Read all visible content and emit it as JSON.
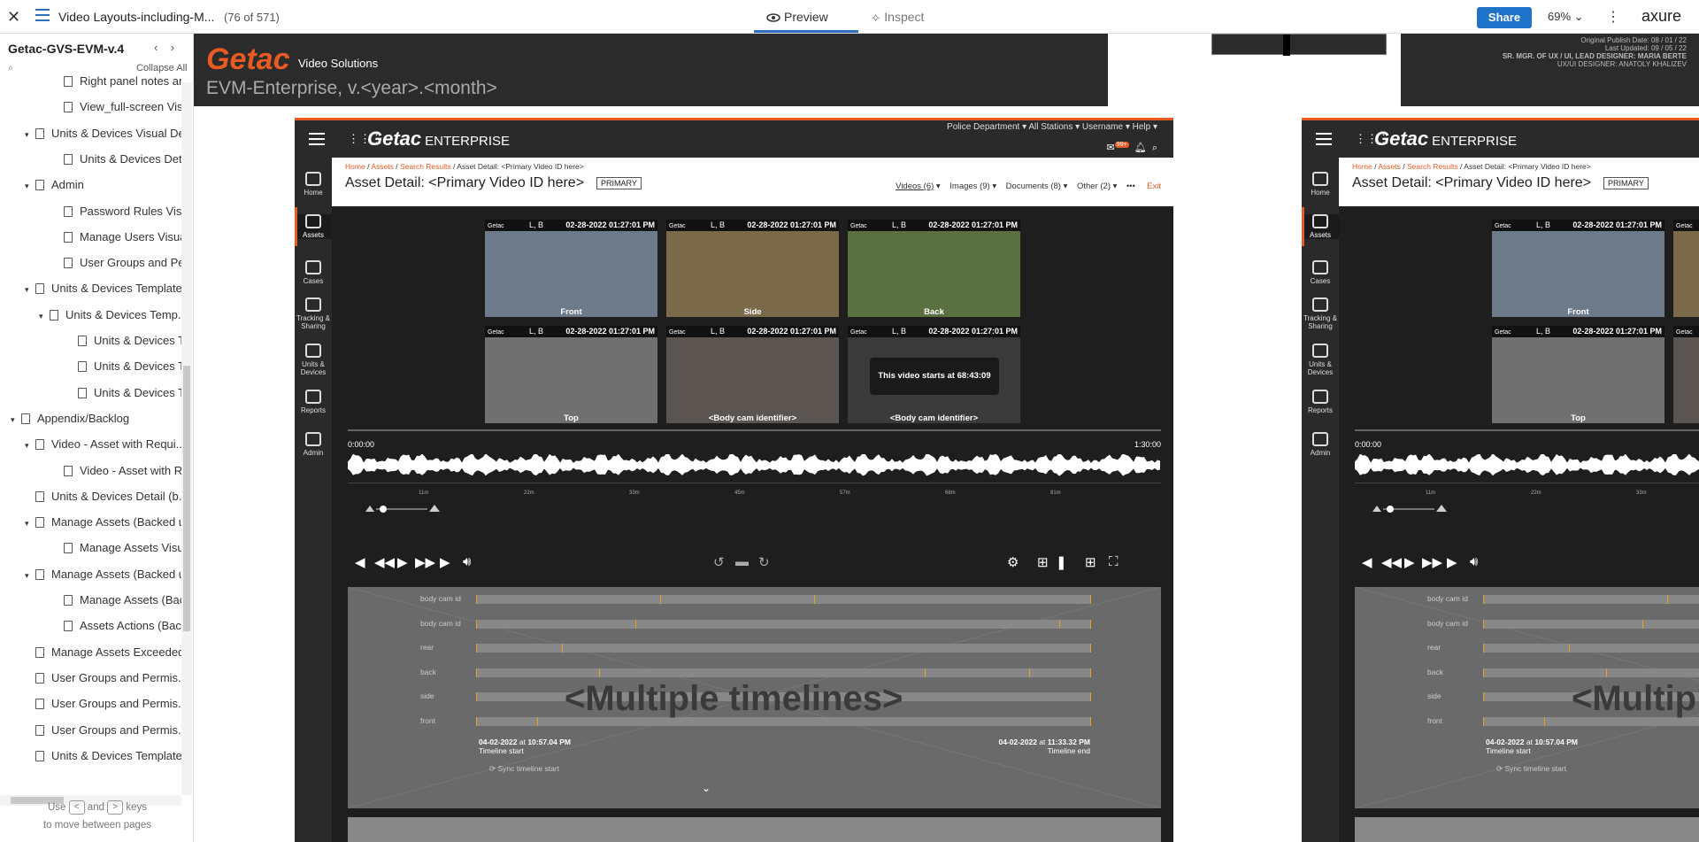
{
  "topbar": {
    "close_glyph": "✕",
    "page_title": "Video Layouts-including-M...",
    "page_count": "(76 of 571)",
    "tab_preview": "Preview",
    "tab_inspect": "Inspect",
    "share": "Share",
    "zoom": "69%",
    "brand": "axure"
  },
  "sidebar": {
    "project": "Getac-GVS-EVM-v.4",
    "collapse_all": "Collapse All",
    "hint_prefix": "Use",
    "hint_and": "and",
    "hint_keys": "keys",
    "hint_line2": "to move between pages",
    "items": [
      {
        "label": "Right panel notes and...",
        "caret": ""
      },
      {
        "label": "View_full-screen Visu...",
        "caret": ""
      },
      {
        "label": "Units & Devices Visual De...",
        "caret": "▾"
      },
      {
        "label": "Units & Devices Detail...",
        "caret": ""
      },
      {
        "label": "Admin",
        "caret": "▾"
      },
      {
        "label": "Password Rules Visual...",
        "caret": ""
      },
      {
        "label": "Manage Users Visual I...",
        "caret": ""
      },
      {
        "label": "User Groups and Perr...",
        "caret": ""
      },
      {
        "label": "Units & Devices Template...",
        "caret": "▾"
      },
      {
        "label": "Units & Devices Temp...",
        "caret": "▾"
      },
      {
        "label": "Units & Devices Te...",
        "caret": ""
      },
      {
        "label": "Units & Devices Te...",
        "caret": ""
      },
      {
        "label": "Units & Devices Te...",
        "caret": ""
      },
      {
        "label": "Appendix/Backlog",
        "caret": "▾"
      },
      {
        "label": "Video - Asset with Requi...",
        "caret": "▾"
      },
      {
        "label": "Video - Asset with Rec...",
        "caret": ""
      },
      {
        "label": "Units & Devices Detail (b...",
        "caret": ""
      },
      {
        "label": "Manage Assets (Backed u...",
        "caret": "▾"
      },
      {
        "label": "Manage Assets Visual...",
        "caret": ""
      },
      {
        "label": "Manage Assets (Backed u...",
        "caret": "▾"
      },
      {
        "label": "Manage Assets (Backe...",
        "caret": ""
      },
      {
        "label": "Assets Actions (Backe...",
        "caret": ""
      },
      {
        "label": "Manage Assets Exceeded...",
        "caret": ""
      },
      {
        "label": "User Groups and Permis...",
        "caret": ""
      },
      {
        "label": "User Groups and Permis...",
        "caret": ""
      },
      {
        "label": "User Groups and Permis...",
        "caret": ""
      },
      {
        "label": "Units & Devices Template...",
        "caret": ""
      }
    ]
  },
  "canvas": {
    "logo": "Getac",
    "logo_sub": "Video Solutions",
    "version": "EVM-Enterprise,   v.<year>.<month>",
    "info_lines": [
      "Original Publish Date: 08 / 01 / 22",
      "Last Updated: 09 / 05 / 22",
      "SR. MGR. OF UX / UI, LEAD DESIGNER: MARIA BERTE",
      "UX/UI DESIGNER: ANATOLY KHALIZEV"
    ]
  },
  "app": {
    "brand": "Getac",
    "brand_sub": "ENTERPRISE",
    "top_links": "Police Department ▾   All Stations ▾   Username ▾   Help ▾",
    "badge": "99+",
    "nav": [
      "Home",
      "Assets",
      "Cases",
      "Tracking & Sharing",
      "Units & Devices",
      "Reports",
      "Admin"
    ],
    "breadcrumb": [
      "Home",
      "Assets",
      "Search Results"
    ],
    "breadcrumb_current": "Asset Detail: <Primary Video ID here>",
    "title": "Asset Detail: <Primary Video ID here>",
    "primary": "PRIMARY",
    "menus": [
      "Videos (6)",
      "Images (9)",
      "Documents (8)",
      "Other (2)"
    ],
    "exit": "Exit",
    "tiles": [
      {
        "brand": "Getac",
        "cam": "L, B",
        "date": "02-28-2022  01:27:01 PM",
        "label": "Front",
        "color": "#6c7a8a"
      },
      {
        "brand": "Getac",
        "cam": "L, B",
        "date": "02-28-2022  01:27:01 PM",
        "label": "Side",
        "color": "#7a6a4a"
      },
      {
        "brand": "Getac",
        "cam": "L, B",
        "date": "02-28-2022  01:27:01 PM",
        "label": "Back",
        "color": "#5a7040"
      },
      {
        "brand": "Getac",
        "cam": "L, B",
        "date": "02-28-2022  01:27:01 PM",
        "label": "Top",
        "color": "#707070"
      },
      {
        "brand": "Getac",
        "cam": "L, B",
        "date": "02-28-2022  01:27:01 PM",
        "label": "<Body cam identifier>",
        "color": "#5a5550"
      },
      {
        "brand": "Getac",
        "cam": "L, B",
        "date": "02-28-2022  01:27:01 PM",
        "label": "<Body cam identifier>",
        "color": "#3a3a3a",
        "message": "This video starts at 68:43:09"
      }
    ],
    "time_start": "0:00:00",
    "time_end": "1:30:00",
    "ruler_ticks": [
      "11m",
      "22m",
      "33m",
      "45m",
      "57m",
      "68m",
      "81m"
    ],
    "timeline_rows": [
      "body cam id",
      "body cam id",
      "rear",
      "back",
      "side",
      "front"
    ],
    "multi_label": "<Multiple timelines>",
    "tl_start_date": "04-02-2022",
    "tl_start_at": "at",
    "tl_start_time": "10:57.04 PM",
    "tl_start_label": "Timeline start",
    "tl_end_date": "04-02-2022",
    "tl_end_at": "at",
    "tl_end_time": "11:33.32 PM",
    "tl_end_label": "Timeline end",
    "sync": "Sync timeline start"
  }
}
